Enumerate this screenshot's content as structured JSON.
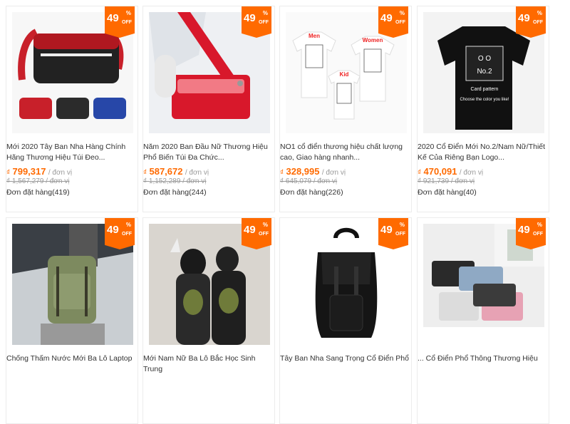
{
  "badge": {
    "percent": "49",
    "percent_sign": "%",
    "off": "OFF"
  },
  "unit_suffix": "/ đơn vị",
  "colors": {
    "accent": "#ff6a00"
  },
  "products": [
    {
      "title": "Mới 2020 Tây Ban Nha Hàng Chính Hãng Thương Hiệu Túi Đeo...",
      "currency": "₫",
      "price": "799,317",
      "old_price": "₫ 1,567,279",
      "orders": "Đơn đặt hàng(419)",
      "image_icon": "crossbody-bag-image"
    },
    {
      "title": "Năm 2020 Ban Đầu Nữ Thương Hiệu Phổ Biến Túi Đa Chức...",
      "currency": "₫",
      "price": "587,672",
      "old_price": "₫ 1,152,289",
      "orders": "Đơn đặt hàng(244)",
      "image_icon": "shoulder-bag-image"
    },
    {
      "title": "NO1 cổ điển thương hiệu chất lượng cao, Giao hàng nhanh...",
      "currency": "₫",
      "price": "328,995",
      "old_price": "₫ 645,079",
      "orders": "Đơn đặt hàng(226)",
      "image_icon": "family-tshirts-image",
      "shirt_labels": {
        "men": "Men",
        "women": "Women",
        "kid": "Kid",
        "print": "DIY Your Print or logo"
      }
    },
    {
      "title": "2020 Cổ Điển Mới No.2/Nam Nữ/Thiết Kế Của Riêng Bạn Logo...",
      "currency": "₫",
      "price": "470,091",
      "old_price": "₫ 921,739",
      "orders": "Đơn đặt hàng(40)",
      "image_icon": "black-tshirt-image",
      "shirt_labels": {
        "logo": "No.2",
        "card": "Card pattern",
        "choose": "Choose the color you like!"
      }
    },
    {
      "title": "Chống Thấm Nước Mới Ba Lô Laptop",
      "image_icon": "green-backpack-image"
    },
    {
      "title": "Mới Nam Nữ Ba Lô Bắc Học Sinh Trung",
      "image_icon": "couple-backpacks-image"
    },
    {
      "title": "Tây Ban Nha Sang Trọng Cổ Điển Phổ",
      "image_icon": "black-leather-backpack-image"
    },
    {
      "title": "... Cổ Điển Phổ Thông Thương Hiệu",
      "image_icon": "cosmetic-pouches-image"
    }
  ]
}
